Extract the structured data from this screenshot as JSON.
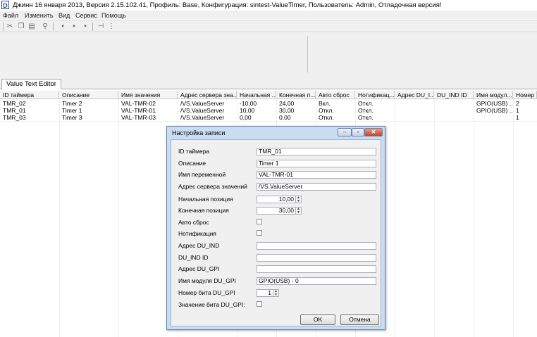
{
  "window": {
    "title": "Джинн 16 января 2013, Версия 2.15.102.41, Профиль: Base, Конфигурация: sintest-ValueTimer, Пользователь: Admin, Отладочная версия!",
    "icon": "app-icon"
  },
  "menu": [
    "Файл",
    "Изменить",
    "Вид",
    "Сервис",
    "Помощь"
  ],
  "toolbar": [
    "cut-icon",
    "copy-icon",
    "paste-icon",
    "find-icon",
    "align-left-icon",
    "align-center-icon",
    "align-right-icon",
    "pin-icon",
    "properties-icon"
  ],
  "tab": {
    "label": "Value Text Editor"
  },
  "grid": {
    "columns": [
      "ID таймера",
      "Описание",
      "Имя значения",
      "Адрес сервера зна...",
      "Начальная ...",
      "Конечная п...",
      "Авто сброс",
      "Нотификац...",
      "Адрес DU_I...",
      "DU_IND ID",
      "Имя модул...",
      "Номер ..."
    ],
    "rows": [
      [
        "TMR_02",
        "Timer 2",
        "VAL-TMR-02",
        "/VS.ValueServer",
        "-10,00",
        "24,00",
        "Вкл.",
        "Откл.",
        "",
        "",
        "GPIO(USB) ...",
        "2"
      ],
      [
        "TMR_01",
        "Timer 1",
        "VAL-TMR-01",
        "/VS.ValueServer",
        "10,00",
        "30,00",
        "Откл.",
        "Откл.",
        "",
        "",
        "GPIO(USB) ...",
        "1"
      ],
      [
        "TMR_03",
        "Timer 3",
        "VAL-TMR-03",
        "/VS.ValueServer",
        "0,00",
        "0,00",
        "Откл.",
        "Откл.",
        "",
        "",
        "",
        "1"
      ]
    ]
  },
  "dialog": {
    "title": "Настройка записи",
    "fields": {
      "timer_id": {
        "label": "ID таймера",
        "value": "TMR_01"
      },
      "description": {
        "label": "Описание",
        "value": "Timer 1"
      },
      "var_name": {
        "label": "Имя переменной",
        "value": "VAL-TMR-01"
      },
      "server_address": {
        "label": "Адрес сервера значений",
        "value": "/VS.ValueServer"
      },
      "start_pos": {
        "label": "Начальная позиция",
        "value": "10,00"
      },
      "end_pos": {
        "label": "Конечная позиция",
        "value": "30,00"
      },
      "auto_reset": {
        "label": "Авто сброс",
        "checked": false
      },
      "notification": {
        "label": "Нотификация",
        "checked": false
      },
      "du_ind_address": {
        "label": "Адрес DU_IND",
        "value": ""
      },
      "du_ind_id": {
        "label": "DU_IND ID",
        "value": ""
      },
      "du_gpi_address": {
        "label": "Адрес DU_GPI",
        "value": ""
      },
      "du_gpi_module": {
        "label": "Имя модуля DU_GPI",
        "value": "GPIO(USB) - 0"
      },
      "du_gpi_bit": {
        "label": "Номер бита DU_GPI",
        "value": "1"
      },
      "du_gpi_bit_value": {
        "label": "Значение бита DU_GPI:",
        "checked": false
      }
    },
    "ok_label": "OK",
    "cancel_label": "Отмена"
  }
}
